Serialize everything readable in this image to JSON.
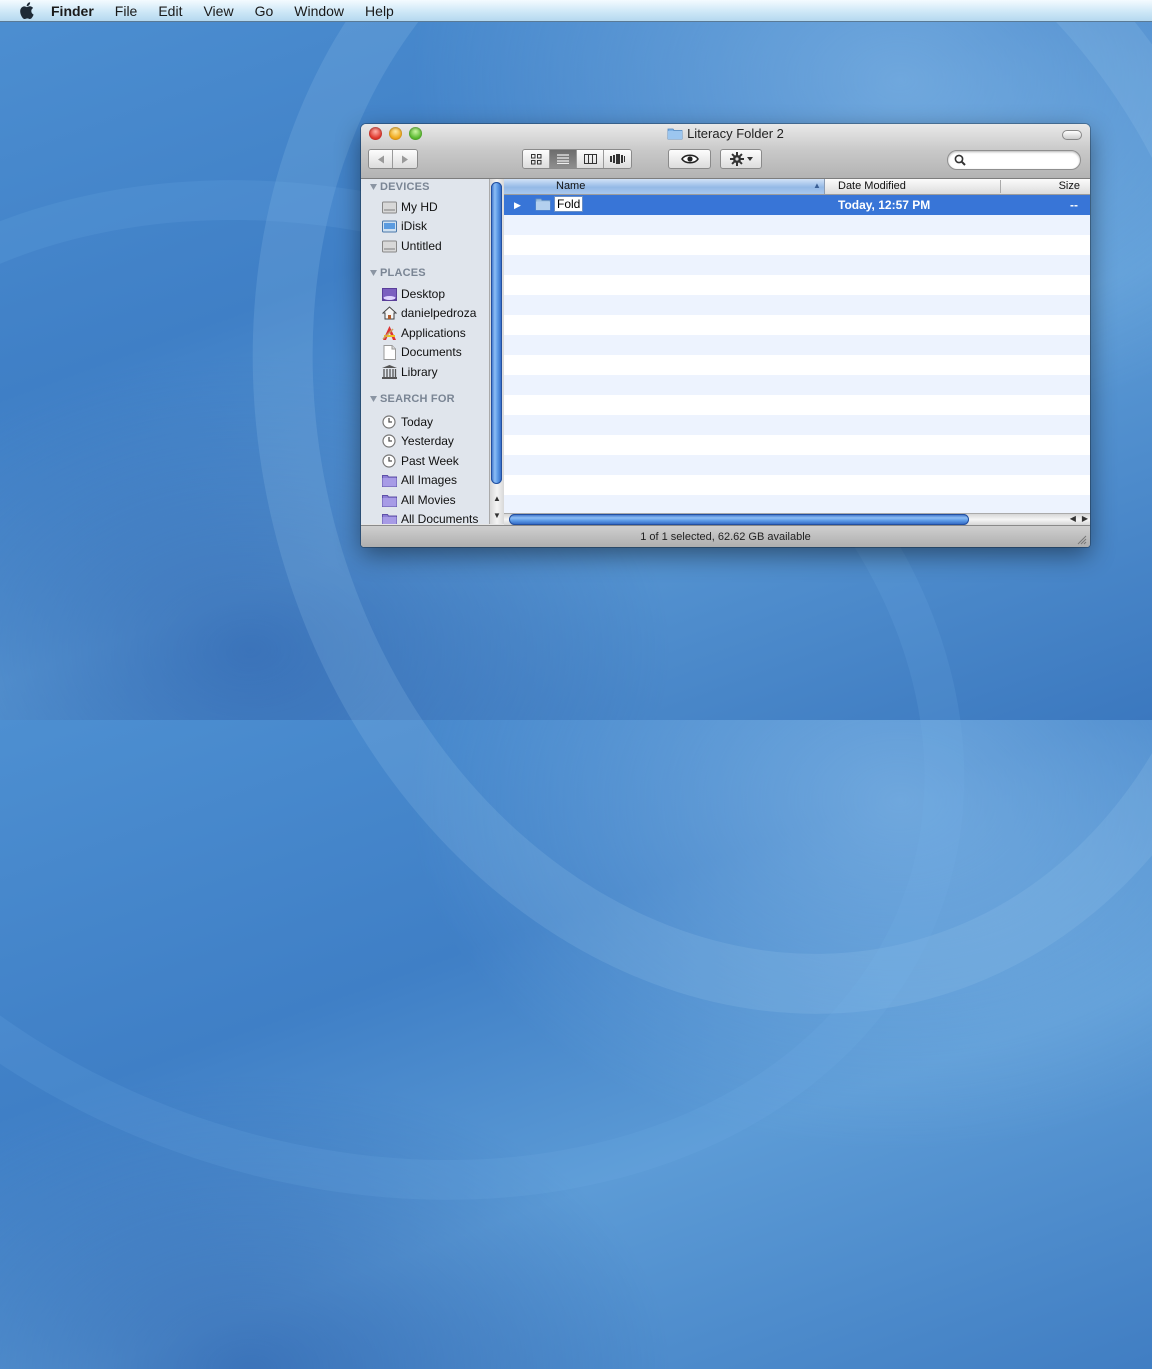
{
  "menubar": {
    "apple_icon": "apple-logo-icon",
    "items": [
      {
        "label": "Finder",
        "bold": true
      },
      {
        "label": "File"
      },
      {
        "label": "Edit"
      },
      {
        "label": "View"
      },
      {
        "label": "Go"
      },
      {
        "label": "Window"
      },
      {
        "label": "Help"
      }
    ]
  },
  "window": {
    "title": "Literacy Folder 2",
    "title_icon": "folder-icon",
    "toolbar": {
      "back_icon": "back-arrow-icon",
      "forward_icon": "forward-arrow-icon",
      "view_modes": [
        {
          "name": "icon-view",
          "active": false
        },
        {
          "name": "list-view",
          "active": true
        },
        {
          "name": "column-view",
          "active": false
        },
        {
          "name": "cover-flow-view",
          "active": false
        }
      ],
      "quick_look_icon": "eye-icon",
      "action_icon": "gear-icon",
      "search_placeholder": "",
      "search_value": ""
    },
    "sidebar": {
      "sections": [
        {
          "label": "DEVICES",
          "items": [
            {
              "label": "My HD",
              "icon": "hard-drive-icon"
            },
            {
              "label": "iDisk",
              "icon": "idisk-icon"
            },
            {
              "label": "Untitled",
              "icon": "hard-drive-icon"
            }
          ]
        },
        {
          "label": "PLACES",
          "items": [
            {
              "label": "Desktop",
              "icon": "desktop-icon"
            },
            {
              "label": "danielpedroza",
              "icon": "home-icon"
            },
            {
              "label": "Applications",
              "icon": "applications-icon"
            },
            {
              "label": "Documents",
              "icon": "documents-icon"
            },
            {
              "label": "Library",
              "icon": "library-icon"
            }
          ]
        },
        {
          "label": "SEARCH FOR",
          "items": [
            {
              "label": "Today",
              "icon": "clock-icon"
            },
            {
              "label": "Yesterday",
              "icon": "clock-icon"
            },
            {
              "label": "Past Week",
              "icon": "clock-icon"
            },
            {
              "label": "All Images",
              "icon": "smart-folder-icon"
            },
            {
              "label": "All Movies",
              "icon": "smart-folder-icon"
            },
            {
              "label": "All Documents",
              "icon": "smart-folder-icon"
            }
          ]
        }
      ]
    },
    "list": {
      "columns": {
        "name": "Name",
        "date": "Date Modified",
        "size": "Size"
      },
      "sort_column": "Name",
      "sort_direction": "ascending",
      "rows": [
        {
          "name": "Fold",
          "editing": true,
          "date": "Today, 12:57 PM",
          "size": "--",
          "selected": true,
          "kind": "folder"
        }
      ]
    },
    "status": "1 of 1 selected, 62.62 GB available"
  }
}
